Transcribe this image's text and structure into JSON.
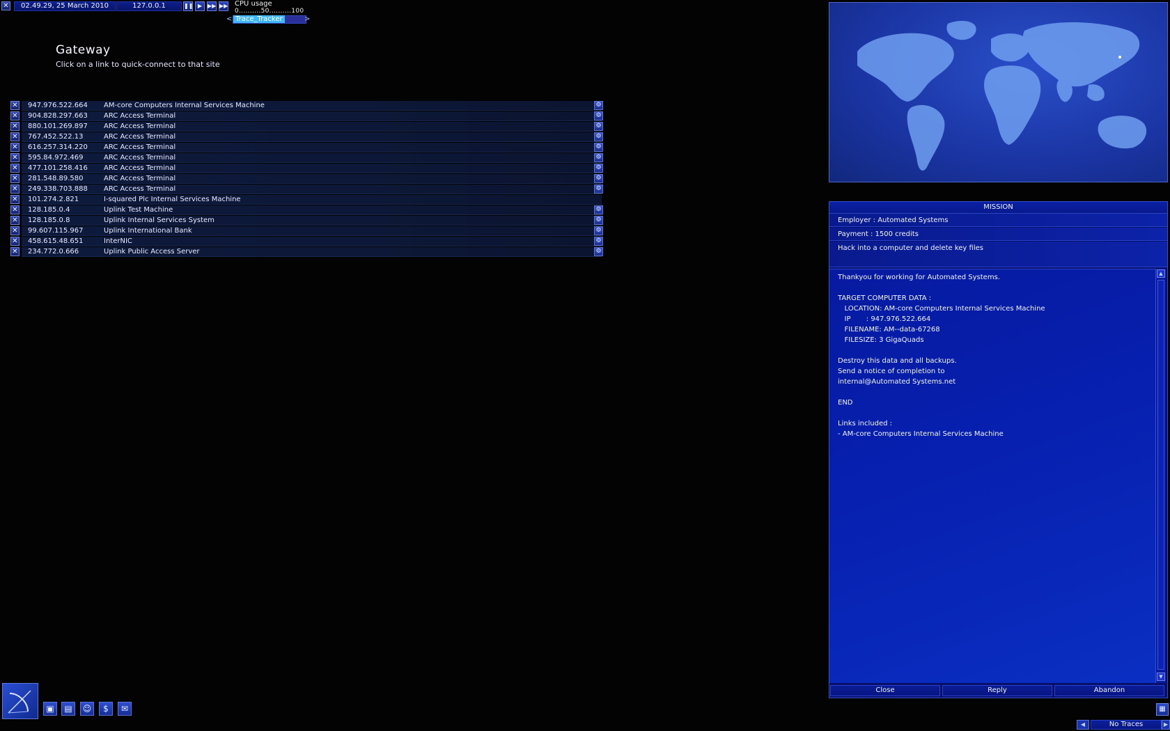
{
  "topbar": {
    "close_icon": "x-icon",
    "datetime": "02.49.29, 25 March 2010",
    "ip": "127.0.0.1",
    "speed_buttons": [
      "pause-icon",
      "play-icon",
      "fast-forward-icon",
      "fastest-forward-icon"
    ],
    "cpu_label": "CPU usage",
    "cpu_scale": "0..........50..........100",
    "trace_prev": "<",
    "trace_next": ">",
    "trace_value": "Trace_Tracker"
  },
  "gateway": {
    "title": "Gateway",
    "subtitle": "Click on a link to quick-connect to that site"
  },
  "links": [
    {
      "ip": "947.976.522.664",
      "name": "AM-core Computers Internal Services Machine",
      "connect": true
    },
    {
      "ip": "904.828.297.663",
      "name": "ARC Access Terminal",
      "connect": true
    },
    {
      "ip": "880.101.269.897",
      "name": "ARC Access Terminal",
      "connect": true
    },
    {
      "ip": "767.452.522.13",
      "name": "ARC Access Terminal",
      "connect": true
    },
    {
      "ip": "616.257.314.220",
      "name": "ARC Access Terminal",
      "connect": true
    },
    {
      "ip": "595.84.972.469",
      "name": "ARC Access Terminal",
      "connect": true
    },
    {
      "ip": "477.101.258.416",
      "name": "ARC Access Terminal",
      "connect": true
    },
    {
      "ip": "281.548.89.580",
      "name": "ARC Access Terminal",
      "connect": true
    },
    {
      "ip": "249.338.703.888",
      "name": "ARC Access Terminal",
      "connect": true
    },
    {
      "ip": "101.274.2.821",
      "name": "I-squared Plc Internal Services Machine",
      "connect": false
    },
    {
      "ip": "128.185.0.4",
      "name": "Uplink Test Machine",
      "connect": true
    },
    {
      "ip": "128.185.0.8",
      "name": "Uplink Internal Services System",
      "connect": true
    },
    {
      "ip": "99.607.115.967",
      "name": "Uplink International Bank",
      "connect": true
    },
    {
      "ip": "458.615.48.651",
      "name": "InterNIC",
      "connect": true
    },
    {
      "ip": "234.772.0.666",
      "name": "Uplink Public Access Server",
      "connect": true
    }
  ],
  "mission": {
    "header": "MISSION",
    "employer": "Employer : Automated Systems",
    "payment": "Payment : 1500 credits",
    "description": "Hack into a computer and delete key files",
    "body": "Thankyou for working for Automated Systems.\n\nTARGET COMPUTER DATA :\n   LOCATION: AM-core Computers Internal Services Machine\n   IP       : 947.976.522.664\n   FILENAME: AM--data-67268\n   FILESIZE: 3 GigaQuads\n\nDestroy this data and all backups.\nSend a notice of completion to\ninternal@Automated Systems.net\n\nEND\n\nLinks included :\n- AM-core Computers Internal Services Machine",
    "buttons": {
      "close": "Close",
      "reply": "Reply",
      "abandon": "Abandon"
    }
  },
  "status": {
    "traces": "No Traces"
  },
  "colors": {
    "background": "#030303",
    "panel": "#06106c",
    "accent": "#2a45c4",
    "highlight": "#41b8f5"
  }
}
